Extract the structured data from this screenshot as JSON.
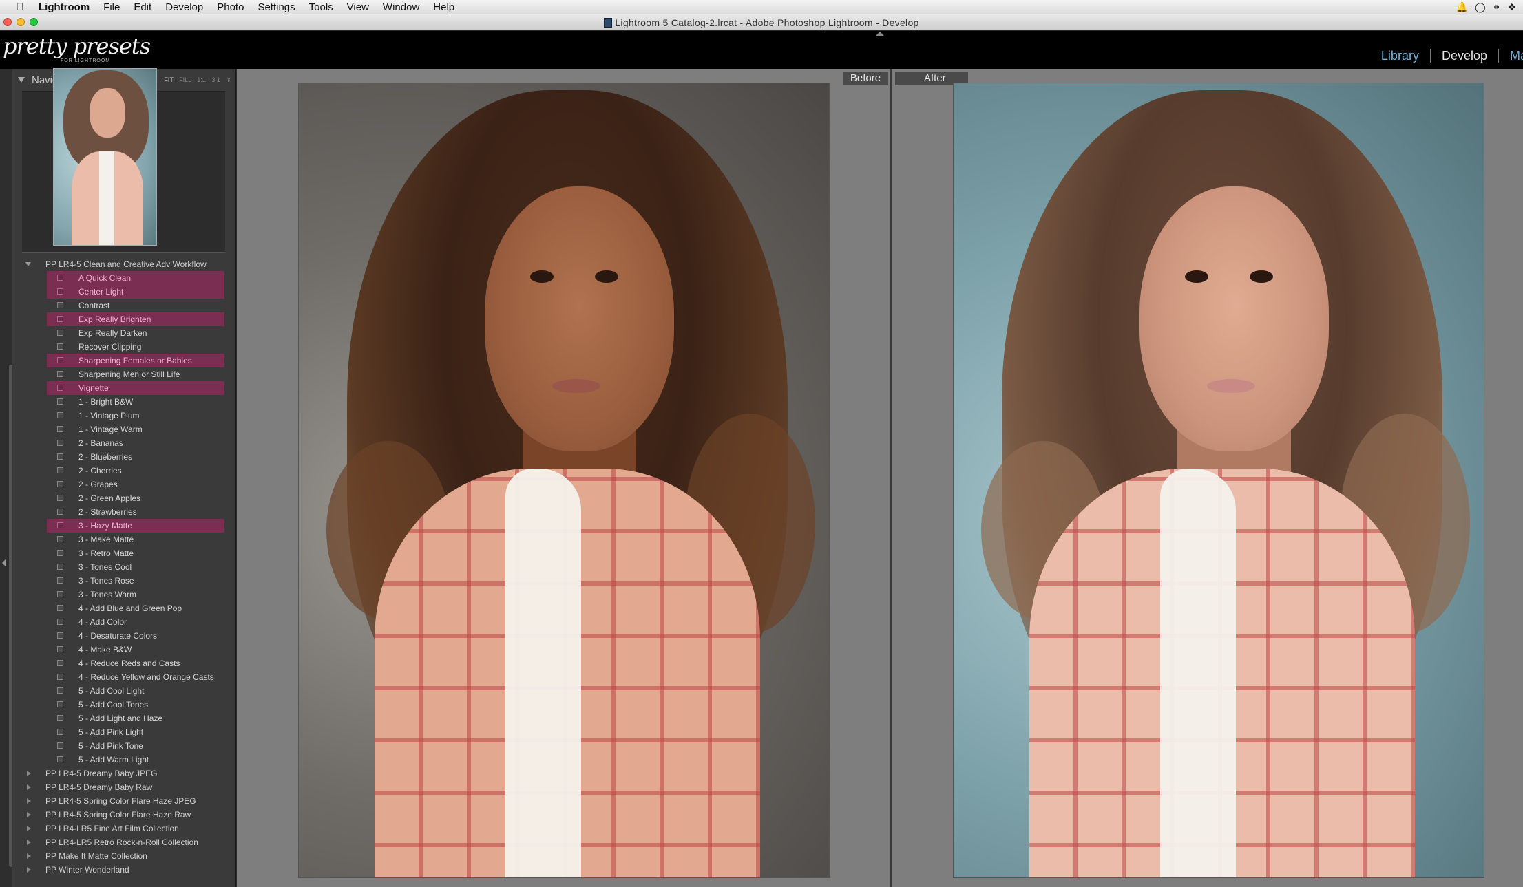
{
  "menubar": {
    "app": "Lightroom",
    "items": [
      "File",
      "Edit",
      "Develop",
      "Photo",
      "Settings",
      "Tools",
      "View",
      "Window",
      "Help"
    ]
  },
  "window": {
    "title": "Lightroom 5 Catalog-2.lrcat - Adobe Photoshop Lightroom - Develop"
  },
  "identity_plate": {
    "logo": "pretty presets",
    "logo_sub": "FOR LIGHTROOM"
  },
  "modules": {
    "library": "Library",
    "develop": "Develop",
    "map_cut": "Ma"
  },
  "navigator": {
    "title": "Navigator",
    "views": [
      "FIT",
      "FILL",
      "1:1",
      "3:1"
    ],
    "active_view": "FIT"
  },
  "presets": {
    "open_folder": "PP LR4-5 Clean and Creative Adv Workflow",
    "items": [
      {
        "label": "A Quick Clean",
        "highlighted": true
      },
      {
        "label": "Center Light",
        "highlighted": true
      },
      {
        "label": "Contrast",
        "highlighted": false
      },
      {
        "label": "Exp Really Brighten",
        "highlighted": true
      },
      {
        "label": "Exp Really Darken",
        "highlighted": false
      },
      {
        "label": "Recover Clipping",
        "highlighted": false
      },
      {
        "label": "Sharpening Females or Babies",
        "highlighted": true
      },
      {
        "label": "Sharpening Men or Still Life",
        "highlighted": false
      },
      {
        "label": "Vignette",
        "highlighted": true
      },
      {
        "label": "1 - Bright B&W",
        "highlighted": false
      },
      {
        "label": "1 - Vintage Plum",
        "highlighted": false
      },
      {
        "label": "1 - Vintage Warm",
        "highlighted": false
      },
      {
        "label": "2 - Bananas",
        "highlighted": false
      },
      {
        "label": "2 - Blueberries",
        "highlighted": false
      },
      {
        "label": "2 - Cherries",
        "highlighted": false
      },
      {
        "label": "2 - Grapes",
        "highlighted": false
      },
      {
        "label": "2 - Green Apples",
        "highlighted": false
      },
      {
        "label": "2 - Strawberries",
        "highlighted": false
      },
      {
        "label": "3 - Hazy Matte",
        "highlighted": true
      },
      {
        "label": "3 - Make Matte",
        "highlighted": false
      },
      {
        "label": "3 - Retro Matte",
        "highlighted": false
      },
      {
        "label": "3 - Tones Cool",
        "highlighted": false
      },
      {
        "label": "3 - Tones Rose",
        "highlighted": false
      },
      {
        "label": "3 - Tones Warm",
        "highlighted": false
      },
      {
        "label": "4 - Add Blue and Green Pop",
        "highlighted": false
      },
      {
        "label": "4 - Add Color",
        "highlighted": false
      },
      {
        "label": "4 - Desaturate Colors",
        "highlighted": false
      },
      {
        "label": "4 - Make B&W",
        "highlighted": false
      },
      {
        "label": "4 - Reduce Reds and Casts",
        "highlighted": false
      },
      {
        "label": "4 - Reduce Yellow and Orange Casts",
        "highlighted": false
      },
      {
        "label": "5 - Add Cool Light",
        "highlighted": false
      },
      {
        "label": "5 - Add Cool Tones",
        "highlighted": false
      },
      {
        "label": "5 - Add Light and Haze",
        "highlighted": false
      },
      {
        "label": "5 - Add Pink Light",
        "highlighted": false
      },
      {
        "label": "5 - Add Pink Tone",
        "highlighted": false
      },
      {
        "label": "5 - Add Warm Light",
        "highlighted": false
      }
    ],
    "closed_folders": [
      "PP LR4-5 Dreamy Baby JPEG",
      "PP LR4-5 Dreamy Baby Raw",
      "PP LR4-5 Spring Color Flare Haze JPEG",
      "PP LR4-5 Spring Color Flare Haze Raw",
      "PP LR4-LR5 Fine Art Film Collection",
      "PP LR4-LR5 Retro Rock-n-Roll Collection",
      "PP Make It Matte Collection",
      "PP Winter Wonderland"
    ]
  },
  "compare": {
    "before_label": "Before",
    "after_label": "After"
  }
}
